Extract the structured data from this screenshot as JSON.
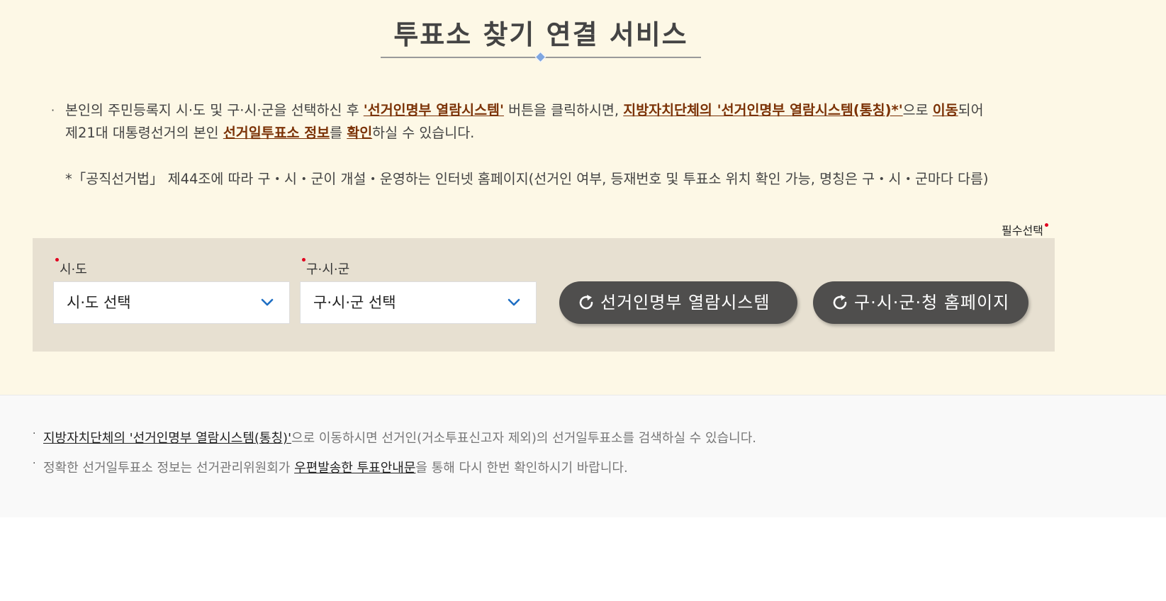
{
  "page": {
    "title": "투표소 찾기 연결 서비스"
  },
  "notice": {
    "p1_a": "본인의 주민등록지 시·도 및 구·시·군을 선택하신 후 ",
    "p1_link1": "'선거인명부 열람시스템'",
    "p1_b": " 버튼을 클릭하시면, ",
    "p1_link2": "지방자치단체의 '선거인명부 열람시스템(통칭)*'",
    "p1_c": "으로 ",
    "p1_link3": "이동",
    "p1_d": "되어",
    "p2_a": "제21대 대통령선거의 본인 ",
    "p2_link1": "선거일투표소 정보",
    "p2_b": "를 ",
    "p2_link2": "확인",
    "p2_c": "하실 수 있습니다.",
    "footnote": "*「공직선거법」 제44조에 따라 구・시・군이 개설・운영하는 인터넷 홈페이지(선거인 여부, 등재번호 및 투표소 위치 확인 가능, 명칭은 구・시・군마다 다름)"
  },
  "form": {
    "required_label": "필수선택",
    "sido_label": "시·도",
    "sido_value": "시·도 선택",
    "sigungu_label": "구·시·군",
    "sigungu_value": "구·시·군 선택",
    "btn_voter_list": "선거인명부 열람시스템",
    "btn_homepage": "구·시·군·청 홈페이지"
  },
  "bottom": {
    "item1_link": "지방자치단체의 '선거인명부 열람시스템(통칭)'",
    "item1_rest": "으로 이동하시면 선거인(거소투표신고자 제외)의 선거일투표소를 검색하실 수 있습니다.",
    "item2_a": "정확한 선거일투표소 정보는 선거관리위원회가 ",
    "item2_link": "우편발송한 투표안내문",
    "item2_b": "을 통해 다시 한번 확인하시기 바랍니다."
  },
  "colors": {
    "background_top": "#fdf8e6",
    "panel": "#e7e0d1",
    "link_accent": "#7b3206",
    "button": "#4f4e4d",
    "chevron": "#1f6fc4",
    "required_dot": "#e1001e"
  },
  "icons": {
    "select_arrow": "chevron-down-icon",
    "button_icon": "refresh-icon"
  }
}
